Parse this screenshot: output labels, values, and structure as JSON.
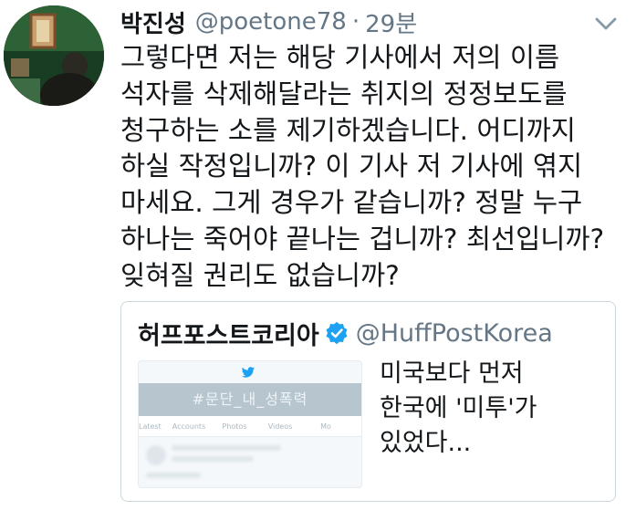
{
  "tweet": {
    "author_name": "박진성",
    "handle": "@poetone78",
    "separator": "·",
    "time": "29분",
    "text_lines": [
      "그렇다면 저는 해당 기사에서 저의 이름",
      "석자를 삭제해달라는 취지의 정정보도를",
      "청구하는 소를 제기하겠습니다. 어디까지",
      "하실 작정입니까? 이 기사 저 기사에 엮지",
      "마세요. 그게 경우가 같습니까? 정말 누구",
      "하나는 죽어야 끝나는 겁니까? 최선입니까?",
      "잊혀질 권리도 없습니까?"
    ],
    "icons": {
      "menu": "chevron-down-icon",
      "avatar": "profile-photo"
    }
  },
  "quoted_tweet": {
    "author_name": "허프포스트코리아",
    "handle": "@HuffPostKorea",
    "verified_icon": "verified-badge-icon",
    "text_lines": [
      "미국보다 먼저",
      "한국에 '미투'가",
      "있었다..."
    ],
    "thumbnail": {
      "hashtag": "#문단_내_성폭력",
      "tabs": [
        "Latest",
        "Accounts",
        "Photos",
        "Videos",
        "Mo"
      ],
      "bird_icon": "twitter-bird-icon"
    }
  },
  "colors": {
    "text": "#14171a",
    "secondary": "#657786",
    "border": "#ccd6dd",
    "verified": "#1da1f2",
    "thumb_banner": "#b7c5cf"
  }
}
